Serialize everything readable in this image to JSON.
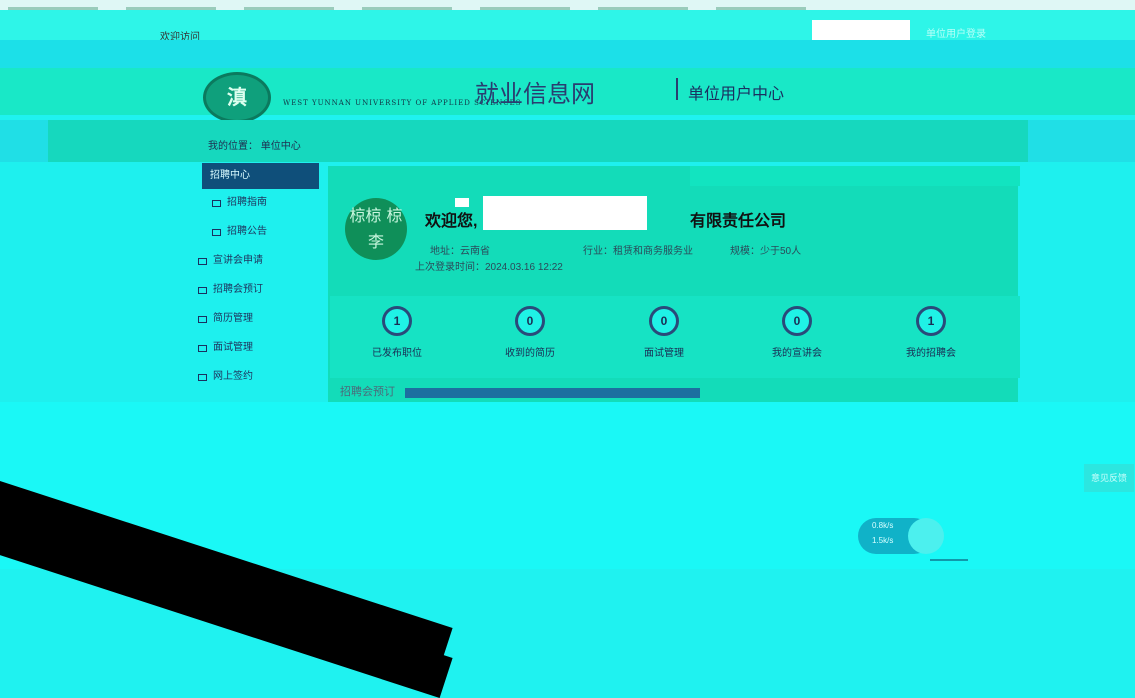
{
  "topbar": {
    "welcome_text": "欢迎访问",
    "login_link": "单位用户登录"
  },
  "header": {
    "logo_text": "滇",
    "school_en": "WEST YUNNAN UNIVERSITY OF APPLIED SCIENCES",
    "site_name": "就业信息网",
    "site_sub": "单位用户中心"
  },
  "breadcrumb": "我的位置： 单位中心",
  "sidebar": {
    "active": "招聘中心",
    "items": [
      {
        "label": "招聘指南"
      },
      {
        "label": "招聘公告"
      },
      {
        "label": "宣讲会申请"
      },
      {
        "label": "招聘会预订"
      },
      {
        "label": "简历管理"
      },
      {
        "label": "面试管理"
      },
      {
        "label": "网上签约"
      }
    ]
  },
  "profile": {
    "avatar_text": "椋椋 椋李",
    "welcome": "欢迎您,",
    "company_suffix": "有限责任公司",
    "address": "地址：云南省",
    "industry": "行业：租赁和商务服务业",
    "scale": "规模：少于50人",
    "last_login": "上次登录时间：2024.03.16 12:22"
  },
  "stats": [
    {
      "label": "已发布职位",
      "value": "1"
    },
    {
      "label": "收到的简历",
      "value": "0"
    },
    {
      "label": "面试管理",
      "value": "0"
    },
    {
      "label": "我的宣讲会",
      "value": "0"
    },
    {
      "label": "我的招聘会",
      "value": "1"
    }
  ],
  "notice": "招聘会预订",
  "feedback_label": "意见反馈",
  "speed": {
    "up": "0.8k/s",
    "down": "1.5k/s"
  }
}
